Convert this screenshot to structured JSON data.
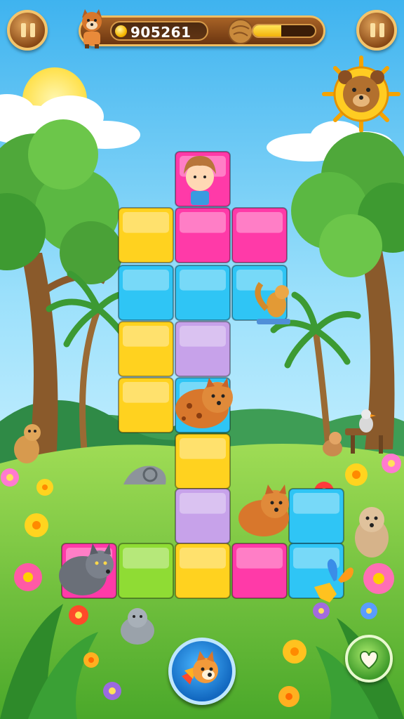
{
  "hud": {
    "coins": "905261",
    "level_progress": 0.45
  },
  "icons": {
    "pause_left": "pause-icon",
    "pause_right": "pause-icon",
    "avatar": "fox-avatar-icon",
    "coin": "coin-icon",
    "progress_badge": "nut-icon",
    "sun_bear": "bear-sun-icon",
    "boost": "fox-boost-icon",
    "favorite": "heart-icon"
  },
  "colors": {
    "sky": "#6fc9f3",
    "grass": "#7ed04a",
    "block_yellow": "#ffd21f",
    "block_pink": "#ff3aa8",
    "block_cyan": "#2fc5f5",
    "block_lime": "#8fdc34",
    "block_lilac": "#c7a2ea",
    "hud_wood": "#8a4a17"
  },
  "board": {
    "rows": [
      [
        "",
        "pink",
        "",
        ""
      ],
      [
        "yellow",
        "pink",
        "pink",
        ""
      ],
      [
        "cyan",
        "cyan",
        "cyan",
        ""
      ],
      [
        "yellow",
        "lilac",
        "",
        ""
      ],
      [
        "yellow",
        "cyan",
        "",
        ""
      ],
      [
        "",
        "yellow",
        "",
        ""
      ],
      [
        "",
        "lilac",
        "",
        "cyan"
      ],
      [
        "pink",
        "lime",
        "yellow",
        "pink",
        "cyan"
      ]
    ]
  }
}
